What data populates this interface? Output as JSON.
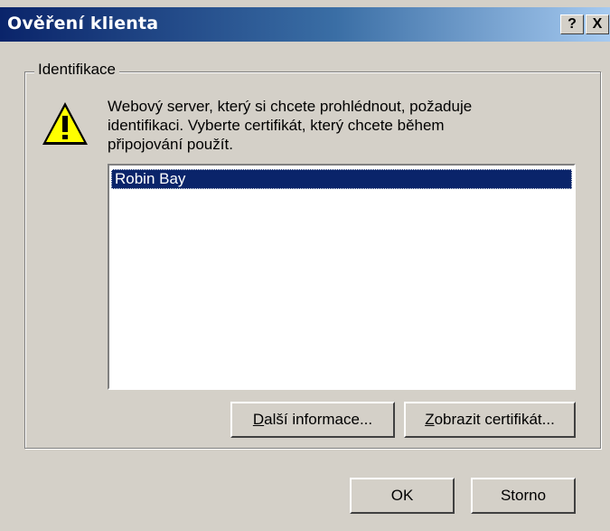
{
  "window": {
    "title": "Ověření klienta",
    "help_label": "?",
    "close_label": "X"
  },
  "group": {
    "label": "Identifikace"
  },
  "message": {
    "line1": "Webový server, který si chcete prohlédnout, požaduje",
    "line2": "identifikaci. Vyberte certifikát, který chcete během",
    "line3": "připojování použít."
  },
  "certificates": {
    "items": [
      "Robin Bay"
    ],
    "selected": "Robin Bay"
  },
  "buttons": {
    "more_info_access": "D",
    "more_info_rest": "alší informace...",
    "view_cert_access": "Z",
    "view_cert_rest": "obrazit certifikát...",
    "ok": "OK",
    "cancel": "Storno"
  },
  "icons": {
    "warning": "warning-icon"
  }
}
